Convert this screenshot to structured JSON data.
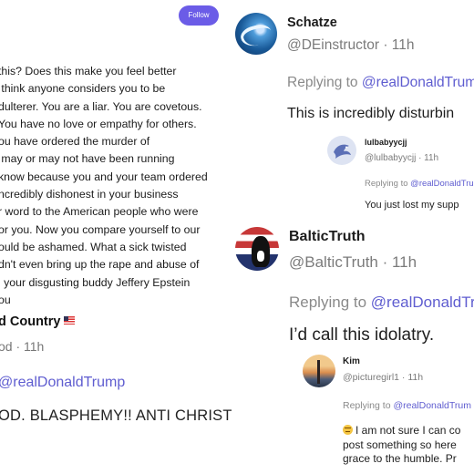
{
  "left_panel": {
    "follow_label": "Follow",
    "caret": "‹",
    "long_text": "this? Does this make you feel better\n think anyone considers you to be\ndulterer. You are a liar. You are covetous.\nYou have no love or empathy for others.\nou have ordered the murder of\n may or may not have been running\nknow because you and your team ordered\nncredibly dishonest in your business\nr word to the American people who were\nor you. Now you compare yourself to our\nould be ashamed. What a sick twisted\ndn't even bring up the rape and abuse of\nl your disgusting buddy Jeffery Epstein\nou",
    "author_name": "d Country",
    "flag_icon": "us-flag-icon",
    "handle_time": "od · 11h",
    "replying": "@realDonaldTrump",
    "body": "OD. BLASPHEMY!! ANTI CHRIST"
  },
  "right_panel": {
    "posts": [
      {
        "name": "Schatze",
        "handle_time": "@DEinstructor · 11h",
        "replying_prefix": "Replying to ",
        "replying_mention": "@realDonaldTrum",
        "body": "This is incredibly disturbin",
        "avatar": "wave-avatar"
      },
      {
        "name": "lulbabyycjj",
        "handle_time": "@lulbabyycjj · 11h",
        "replying_prefix": "Replying to ",
        "replying_mention": "@realDonaldTrum",
        "body": "You just lost my supp",
        "avatar": "bird-avatar"
      },
      {
        "name": "BalticTruth",
        "handle_time": "@BalticTruth · 11h",
        "replying_prefix": "Replying to ",
        "replying_mention": "@realDonaldTr",
        "body": "I’d call this idolatry.",
        "avatar": "cat-flag-avatar"
      },
      {
        "name": "Kim",
        "handle_time": "@picturegirl1 · 11h",
        "replying_prefix": "Replying to ",
        "replying_mention": "@realDonaldTrum",
        "body": "I am not sure I can co\npost something so here\ngrace to the humble. Pr",
        "avatar": "tower-sunset-avatar",
        "emoji_icon": "grimace-emoji-icon"
      }
    ]
  },
  "colors": {
    "accent": "#5f5dd0",
    "follow_bg": "#6b5ce7",
    "muted": "#7b7b7b"
  }
}
